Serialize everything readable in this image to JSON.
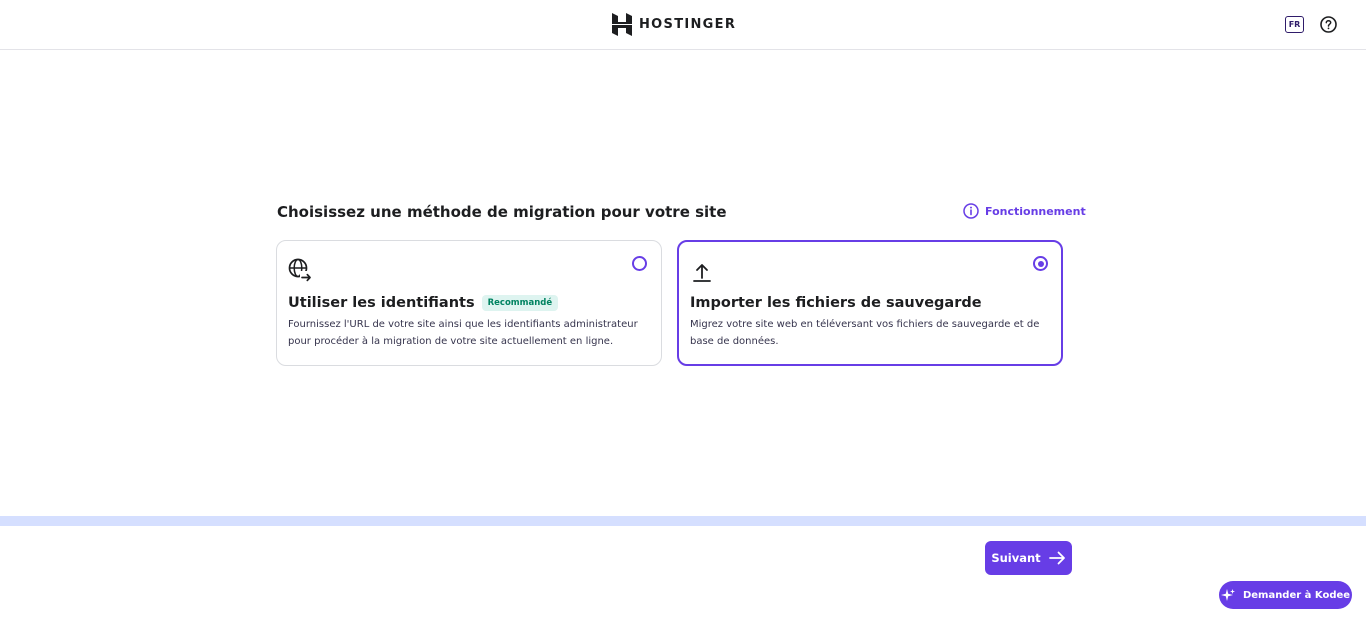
{
  "header": {
    "brand": "HOSTINGER",
    "lang_label": "FR",
    "logo_icon": "hostinger-logo-icon",
    "help_icon": "help-circle-icon"
  },
  "main": {
    "title": "Choisissez une méthode de migration pour votre site",
    "how_link": "Fonctionnement",
    "how_icon": "info-circle-icon",
    "options": [
      {
        "icon": "globe-arrow-icon",
        "title": "Utiliser les identifiants",
        "badge": "Recommandé",
        "description": "Fournissez l'URL de votre site ainsi que les identifiants administrateur pour procéder à la migration de votre site actuellement en ligne.",
        "selected": false
      },
      {
        "icon": "upload-icon",
        "title": "Importer les fichiers de sauvegarde",
        "description": "Migrez votre site web en téléversant vos fichiers de sauvegarde et de base de données.",
        "selected": true
      }
    ]
  },
  "progress": {
    "fraction": 1.0
  },
  "footer": {
    "next_label": "Suivant",
    "kodee_label": "Demander à Kodee"
  },
  "colors": {
    "accent": "#673de6",
    "progress": "#d5dfff",
    "badge_bg": "#def4f0",
    "badge_text": "#008361"
  }
}
